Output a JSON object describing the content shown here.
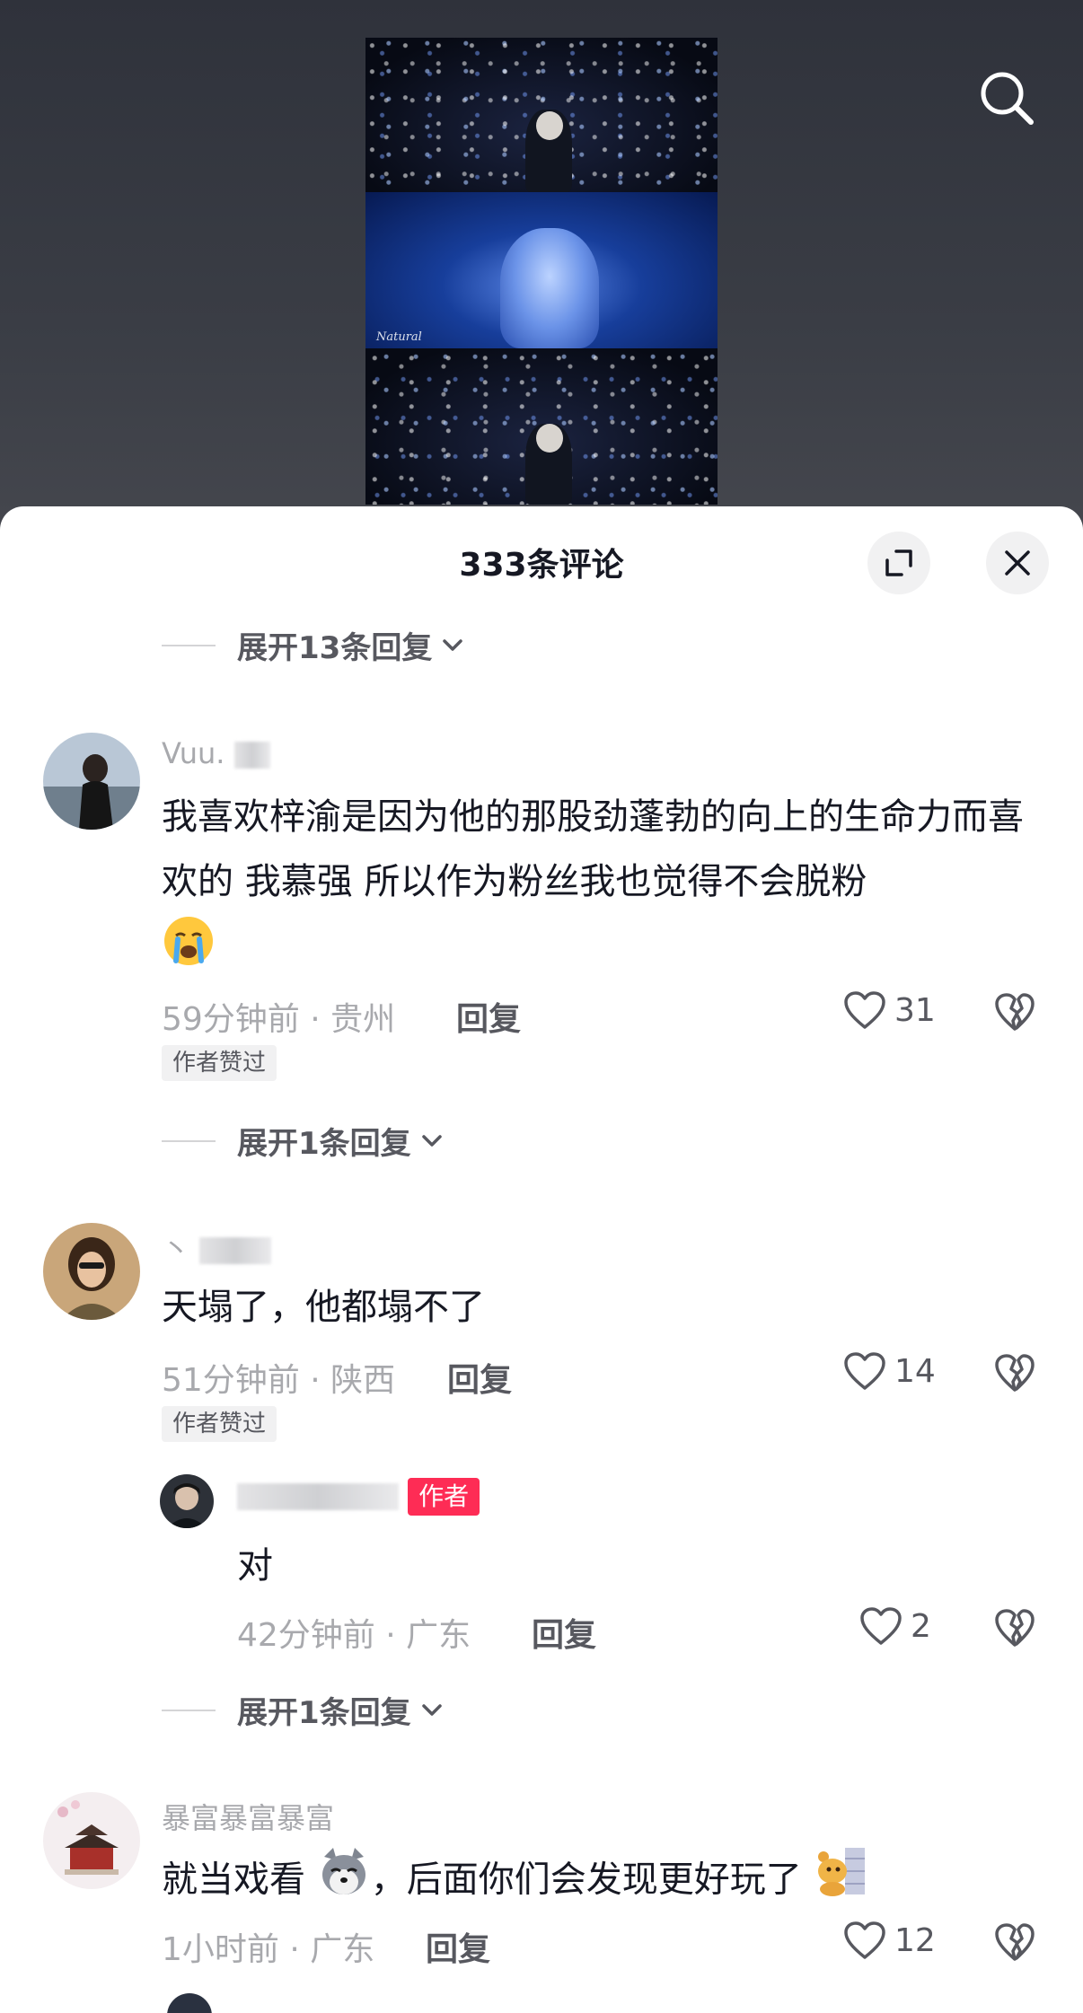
{
  "video": {
    "watermark": "Natural"
  },
  "header": {
    "title": "333条评论"
  },
  "expand_rows": [
    {
      "label": "展开13条回复"
    },
    {
      "label": "展开1条回复"
    },
    {
      "label": "展开1条回复"
    }
  ],
  "comments": [
    {
      "username": "Vuu.",
      "text": "我喜欢梓渝是因为他的那股劲蓬勃的向上的生命力而喜欢的 我慕强 所以作为粉丝我也觉得不会脱粉",
      "emoji": "crying-face",
      "time_location": "59分钟前 · 贵州",
      "reply_label": "回复",
      "likes": "31",
      "author_liked": "作者赞过"
    },
    {
      "username": "丶",
      "text": "天塌了，他都塌不了",
      "time_location": "51分钟前 · 陕西",
      "reply_label": "回复",
      "likes": "14",
      "author_liked": "作者赞过",
      "reply": {
        "username": "",
        "author_tag": "作者",
        "text": "对",
        "time_location": "42分钟前 · 广东",
        "reply_label": "回复",
        "likes": "2"
      }
    },
    {
      "username": "暴富暴富暴富",
      "text_before": "就当戏看",
      "text_after": "，后面你们会发现更好玩了",
      "time_location": "1小时前 · 广东",
      "reply_label": "回复",
      "likes": "12"
    }
  ],
  "colors": {
    "author_tag": "#fe2c55",
    "text_primary": "#161823",
    "text_secondary": "#a8a9ad"
  }
}
